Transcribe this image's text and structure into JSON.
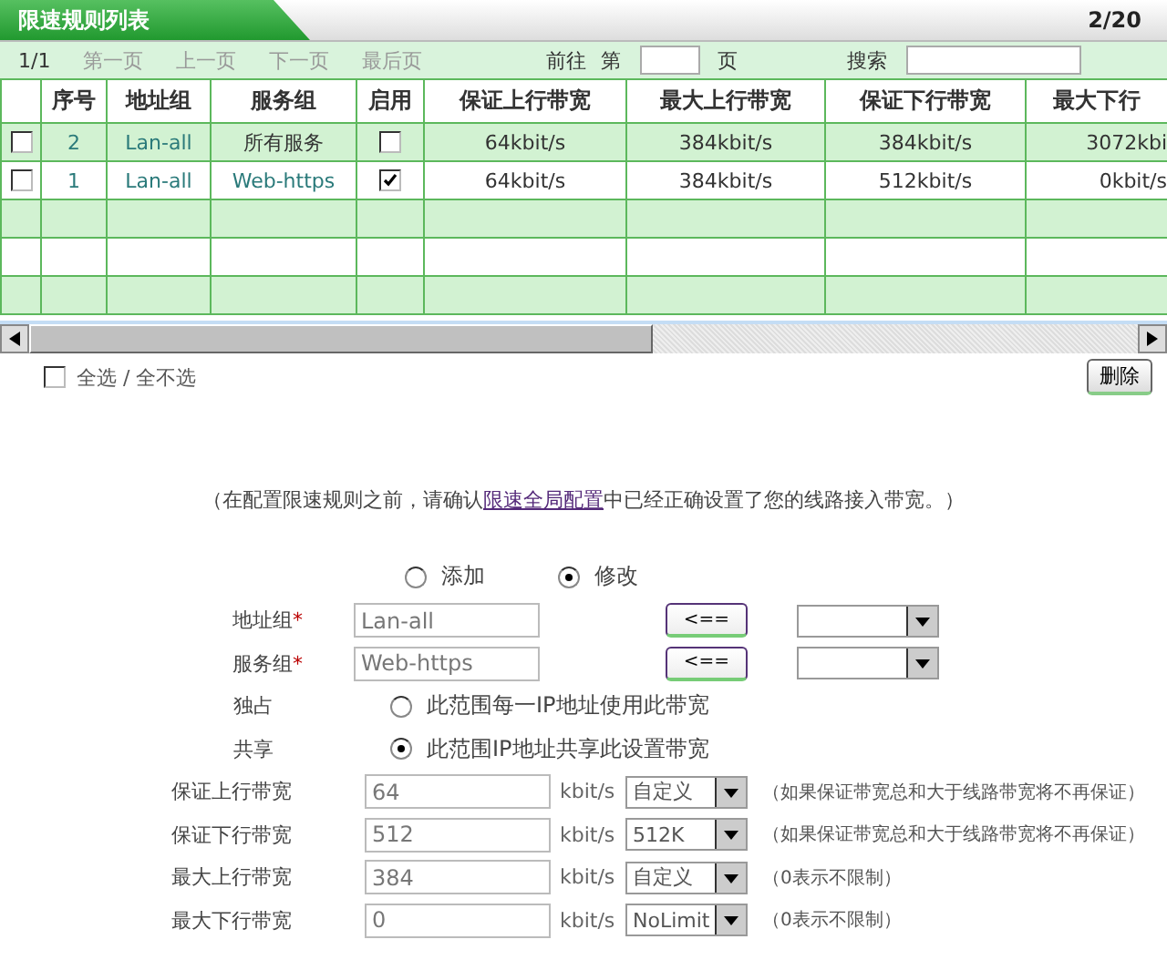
{
  "header": {
    "title": "限速规则列表",
    "count": "2/20"
  },
  "pager": {
    "page": "1/1",
    "links": [
      "第一页",
      "上一页",
      "下一页",
      "最后页"
    ],
    "goto_label": "前往",
    "goto_prefix": "第",
    "goto_suffix": "页",
    "search_label": "搜索"
  },
  "table": {
    "columns": [
      "序号",
      "地址组",
      "服务组",
      "启用",
      "保证上行带宽",
      "最大上行带宽",
      "保证下行带宽",
      "最大下行"
    ],
    "rows": [
      {
        "checked": false,
        "index": "2",
        "address_group": "Lan-all",
        "service_group": "所有服务",
        "service_is_link": false,
        "enabled": false,
        "cells": [
          "64kbit/s",
          "384kbit/s",
          "384kbit/s",
          "3072kbi"
        ]
      },
      {
        "checked": false,
        "index": "1",
        "address_group": "Lan-all",
        "service_group": "Web-https",
        "service_is_link": true,
        "enabled": true,
        "cells": [
          "64kbit/s",
          "384kbit/s",
          "512kbit/s",
          "0kbit/s"
        ]
      }
    ]
  },
  "select_all": {
    "checked": false,
    "label": "全选 / 全不选"
  },
  "delete_button": "删除",
  "note": {
    "before": "（在配置限速规则之前，请确认",
    "link": "限速全局配置",
    "after": "中已经正确设置了您的线路接入带宽。）"
  },
  "mode": [
    {
      "label": "添加",
      "selected": false
    },
    {
      "label": "修改",
      "selected": true
    }
  ],
  "groups": [
    {
      "label": "地址组",
      "mark": "*",
      "value": "Lan-all",
      "button": "<=="
    },
    {
      "label": "服务组",
      "mark": "*",
      "value": "Web-https",
      "button": "<=="
    }
  ],
  "sharing": [
    {
      "label": "独占",
      "text": "此范围每一IP地址使用此带宽",
      "selected": false
    },
    {
      "label": "共享",
      "text": "此范围IP地址共享此设置带宽",
      "selected": true
    }
  ],
  "bandwidth": [
    {
      "label": "保证上行带宽",
      "value": "64",
      "unit": "kbit/s",
      "preset": "自定义",
      "hint": "（如果保证带宽总和大于线路带宽将不再保证）"
    },
    {
      "label": "保证下行带宽",
      "value": "512",
      "unit": "kbit/s",
      "preset": "512K",
      "hint": "（如果保证带宽总和大于线路带宽将不再保证）"
    },
    {
      "label": "最大上行带宽",
      "value": "384",
      "unit": "kbit/s",
      "preset": "自定义",
      "hint": "（0表示不限制）"
    },
    {
      "label": "最大下行带宽",
      "value": "0",
      "unit": "kbit/s",
      "preset": "NoLimit",
      "hint": "（0表示不限制）"
    }
  ]
}
